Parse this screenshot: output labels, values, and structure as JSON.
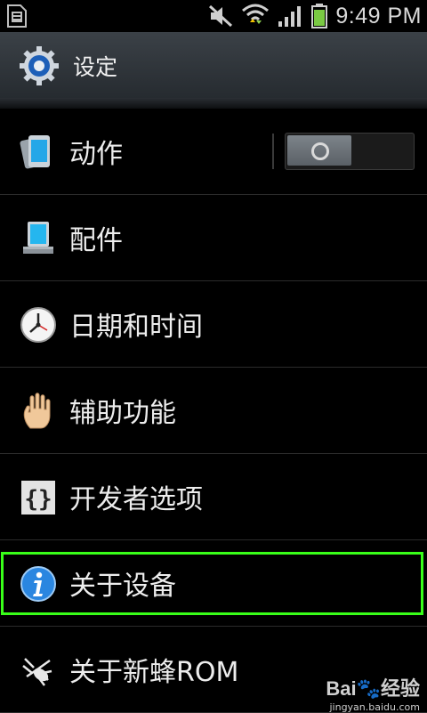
{
  "status_bar": {
    "time": "9:49 PM",
    "icons": [
      "sd-card-icon",
      "mute-icon",
      "wifi-icon",
      "signal-icon",
      "battery-icon"
    ]
  },
  "action_bar": {
    "title": "设定",
    "icon": "settings-gear-icon"
  },
  "settings_items": [
    {
      "label": "动作",
      "icon": "motion-phone-icon",
      "toggle": true,
      "toggle_state": "off"
    },
    {
      "label": "配件",
      "icon": "accessory-dock-icon"
    },
    {
      "label": "日期和时间",
      "icon": "clock-icon"
    },
    {
      "label": "辅助功能",
      "icon": "hand-icon"
    },
    {
      "label": "开发者选项",
      "icon": "braces-icon"
    },
    {
      "label": "关于设备",
      "icon": "info-icon",
      "highlighted": true
    },
    {
      "label": "关于新蜂ROM",
      "icon": "bee-icon"
    }
  ],
  "colors": {
    "highlight": "#39ff19",
    "background": "#000000",
    "action_bar": "#30363b"
  },
  "watermark": {
    "main": "Bai🐾经验",
    "sub": "jingyan.baidu.com"
  }
}
